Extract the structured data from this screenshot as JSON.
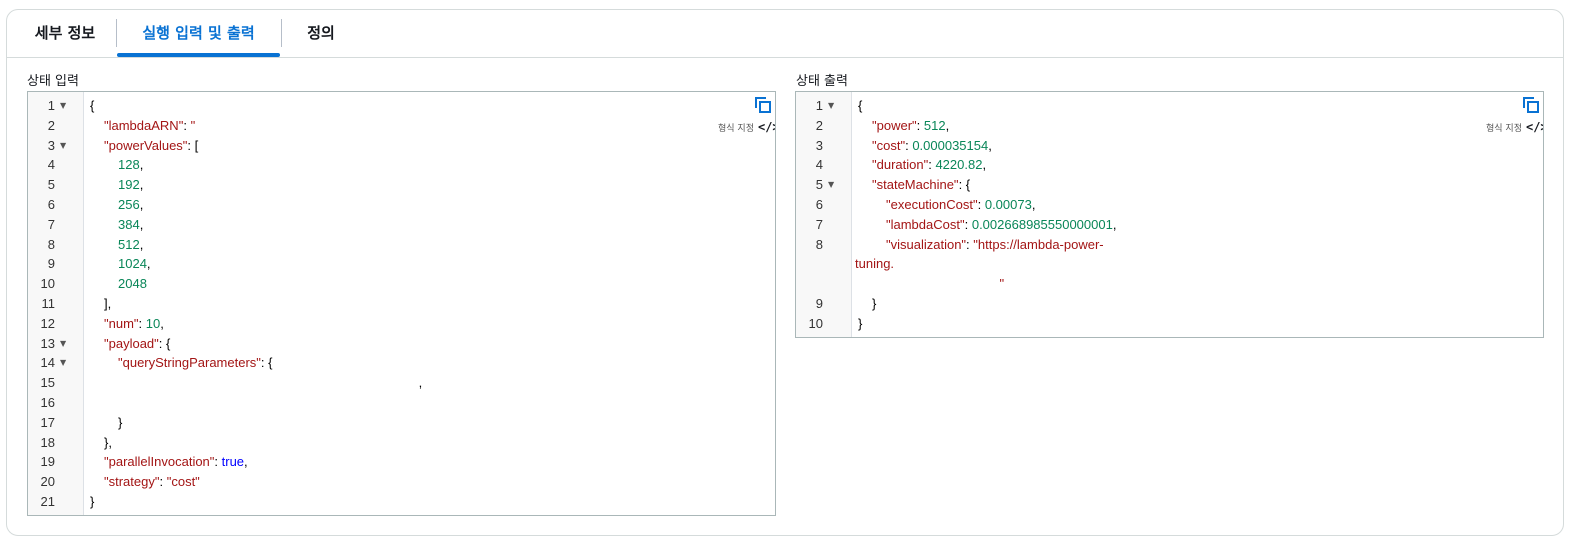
{
  "tabs": [
    {
      "label": "세부 정보",
      "active": false
    },
    {
      "label": "실행 입력 및 출력",
      "active": true
    },
    {
      "label": "정의",
      "active": false
    }
  ],
  "input_panel": {
    "title": "상태 입력",
    "format_label": "형식 지정",
    "lines": [
      {
        "n": "1",
        "fold": true,
        "indent": 0,
        "tokens": [
          [
            "p",
            "{"
          ]
        ]
      },
      {
        "n": "2",
        "fold": false,
        "indent": 1,
        "tokens": [
          [
            "k",
            "\"lambdaARN\""
          ],
          [
            "p",
            ": "
          ],
          [
            "s",
            "\""
          ]
        ]
      },
      {
        "n": "3",
        "fold": true,
        "indent": 1,
        "tokens": [
          [
            "k",
            "\"powerValues\""
          ],
          [
            "p",
            ": ["
          ]
        ]
      },
      {
        "n": "4",
        "fold": false,
        "indent": 2,
        "tokens": [
          [
            "n",
            "128"
          ],
          [
            "p",
            ","
          ]
        ]
      },
      {
        "n": "5",
        "fold": false,
        "indent": 2,
        "tokens": [
          [
            "n",
            "192"
          ],
          [
            "p",
            ","
          ]
        ]
      },
      {
        "n": "6",
        "fold": false,
        "indent": 2,
        "tokens": [
          [
            "n",
            "256"
          ],
          [
            "p",
            ","
          ]
        ]
      },
      {
        "n": "7",
        "fold": false,
        "indent": 2,
        "tokens": [
          [
            "n",
            "384"
          ],
          [
            "p",
            ","
          ]
        ]
      },
      {
        "n": "8",
        "fold": false,
        "indent": 2,
        "tokens": [
          [
            "n",
            "512"
          ],
          [
            "p",
            ","
          ]
        ]
      },
      {
        "n": "9",
        "fold": false,
        "indent": 2,
        "tokens": [
          [
            "n",
            "1024"
          ],
          [
            "p",
            ","
          ]
        ]
      },
      {
        "n": "10",
        "fold": false,
        "indent": 2,
        "tokens": [
          [
            "n",
            "2048"
          ]
        ]
      },
      {
        "n": "11",
        "fold": false,
        "indent": 1,
        "tokens": [
          [
            "p",
            "],"
          ]
        ]
      },
      {
        "n": "12",
        "fold": false,
        "indent": 1,
        "tokens": [
          [
            "k",
            "\"num\""
          ],
          [
            "p",
            ": "
          ],
          [
            "n",
            "10"
          ],
          [
            "p",
            ","
          ]
        ]
      },
      {
        "n": "13",
        "fold": true,
        "indent": 1,
        "tokens": [
          [
            "k",
            "\"payload\""
          ],
          [
            "p",
            ": {"
          ]
        ]
      },
      {
        "n": "14",
        "fold": true,
        "indent": 2,
        "tokens": [
          [
            "k",
            "\"queryStringParameters\""
          ],
          [
            "p",
            ": {"
          ]
        ]
      },
      {
        "n": "15",
        "fold": false,
        "indent": 0,
        "tokens": [
          [
            "p",
            "                                                                                           ,"
          ]
        ]
      },
      {
        "n": "16",
        "fold": false,
        "indent": 0,
        "tokens": []
      },
      {
        "n": "17",
        "fold": false,
        "indent": 2,
        "tokens": [
          [
            "p",
            "}"
          ]
        ]
      },
      {
        "n": "18",
        "fold": false,
        "indent": 1,
        "tokens": [
          [
            "p",
            "},"
          ]
        ]
      },
      {
        "n": "19",
        "fold": false,
        "indent": 1,
        "tokens": [
          [
            "k",
            "\"parallelInvocation\""
          ],
          [
            "p",
            ": "
          ],
          [
            "b",
            "true"
          ],
          [
            "p",
            ","
          ]
        ]
      },
      {
        "n": "20",
        "fold": false,
        "indent": 1,
        "tokens": [
          [
            "k",
            "\"strategy\""
          ],
          [
            "p",
            ": "
          ],
          [
            "s",
            "\"cost\""
          ]
        ]
      },
      {
        "n": "21",
        "fold": false,
        "indent": 0,
        "tokens": [
          [
            "p",
            "}"
          ]
        ]
      }
    ]
  },
  "output_panel": {
    "title": "상태 출력",
    "format_label": "형식 지정",
    "lines": [
      {
        "n": "1",
        "fold": true,
        "indent": 0,
        "tokens": [
          [
            "p",
            "{"
          ]
        ]
      },
      {
        "n": "2",
        "fold": false,
        "indent": 1,
        "tokens": [
          [
            "k",
            "\"power\""
          ],
          [
            "p",
            ": "
          ],
          [
            "n",
            "512"
          ],
          [
            "p",
            ","
          ]
        ]
      },
      {
        "n": "3",
        "fold": false,
        "indent": 1,
        "tokens": [
          [
            "k",
            "\"cost\""
          ],
          [
            "p",
            ": "
          ],
          [
            "n",
            "0.000035154"
          ],
          [
            "p",
            ","
          ]
        ]
      },
      {
        "n": "4",
        "fold": false,
        "indent": 1,
        "tokens": [
          [
            "k",
            "\"duration\""
          ],
          [
            "p",
            ": "
          ],
          [
            "n",
            "4220.82"
          ],
          [
            "p",
            ","
          ]
        ]
      },
      {
        "n": "5",
        "fold": true,
        "indent": 1,
        "tokens": [
          [
            "k",
            "\"stateMachine\""
          ],
          [
            "p",
            ": {"
          ]
        ]
      },
      {
        "n": "6",
        "fold": false,
        "indent": 2,
        "tokens": [
          [
            "k",
            "\"executionCost\""
          ],
          [
            "p",
            ": "
          ],
          [
            "n",
            "0.00073"
          ],
          [
            "p",
            ","
          ]
        ]
      },
      {
        "n": "7",
        "fold": false,
        "indent": 2,
        "tokens": [
          [
            "k",
            "\"lambdaCost\""
          ],
          [
            "p",
            ": "
          ],
          [
            "n",
            "0.002668985550000001"
          ],
          [
            "p",
            ","
          ]
        ]
      },
      {
        "n": "8",
        "fold": false,
        "indent": 2,
        "tokens": [
          [
            "k",
            "\"visualization\""
          ],
          [
            "p",
            ": "
          ],
          [
            "s",
            "\"https://lambda-power-"
          ]
        ]
      },
      {
        "n": "",
        "fold": false,
        "indent": -1,
        "tokens": [
          [
            "s",
            "tuning."
          ]
        ]
      },
      {
        "n": "",
        "fold": false,
        "indent": -1,
        "tokens": [
          [
            "s",
            "                                        \""
          ]
        ]
      },
      {
        "n": "9",
        "fold": false,
        "indent": 1,
        "tokens": [
          [
            "p",
            "}"
          ]
        ]
      },
      {
        "n": "10",
        "fold": false,
        "indent": 0,
        "tokens": [
          [
            "p",
            "}"
          ]
        ]
      }
    ]
  },
  "icons": {
    "copy": "copy-icon",
    "code": "code-icon",
    "fold": "fold-arrow-icon"
  },
  "colors": {
    "accent": "#0972d3",
    "key": "#a31515",
    "number": "#098658",
    "boolean": "#0000ff"
  }
}
